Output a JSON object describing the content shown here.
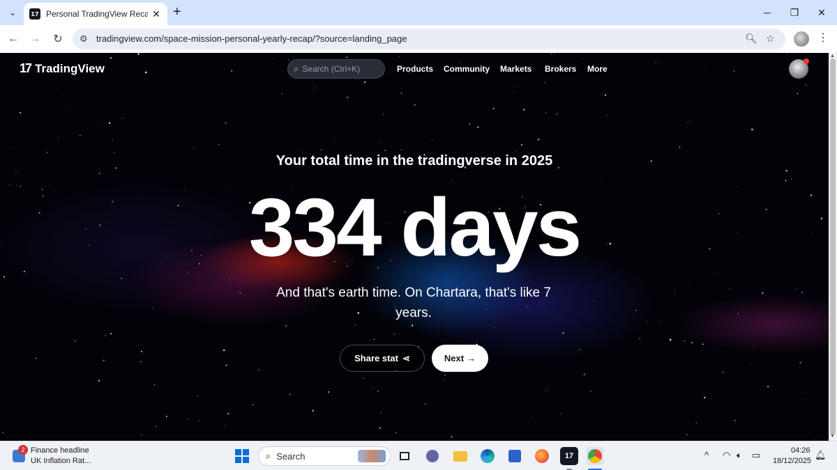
{
  "browser": {
    "tab_title": "Personal TradingView Recap —",
    "favicon_text": "17",
    "url": "tradingview.com/space-mission-personal-yearly-recap/?source=landing_page"
  },
  "site": {
    "logo_mark": "17",
    "logo_text": "TradingView",
    "search_placeholder": "Search (Ctrl+K)",
    "nav": [
      "Products",
      "Community",
      "Markets",
      "Brokers",
      "More"
    ]
  },
  "hero": {
    "subtitle": "Your total time in the tradingverse in 2025",
    "stat": "334 days",
    "tagline": "And that's earth time. On Chartara, that's like 7 years.",
    "share_label": "Share stat",
    "next_label": "Next"
  },
  "taskbar": {
    "news_badge": "2",
    "news_title": "Finance headline",
    "news_subtitle": "UK Inflation Rat...",
    "search_placeholder": "Search",
    "time": "04:26",
    "date": "18/12/2025"
  },
  "colors": {
    "tab_strip": "#d3e3fd",
    "page_bg": "#020208",
    "accent_red": "#f23645",
    "windows_blue": "#0a6cd6"
  },
  "icons": [
    "search-icon",
    "back-arrow-icon",
    "forward-arrow-icon",
    "reload-icon",
    "site-info-icon",
    "zoom-icon",
    "bookmark-star-icon",
    "kebab-menu-icon",
    "share-icon",
    "arrow-right-icon",
    "windows-start-icon",
    "wifi-icon",
    "speaker-icon",
    "battery-icon",
    "bell-icon"
  ]
}
